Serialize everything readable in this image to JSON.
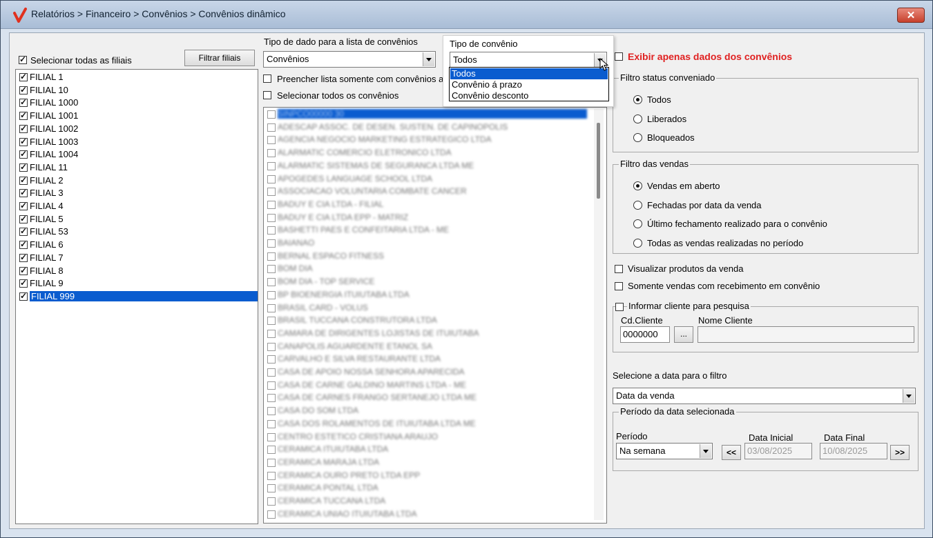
{
  "window": {
    "title": "Relatórios > Financeiro > Convênios > Convênios dinâmico",
    "close_label": "✕"
  },
  "filiais": {
    "select_all_label": "Selecionar todas as filiais",
    "filter_button": "Filtrar filiais",
    "items": [
      {
        "label": "FILIAL 1"
      },
      {
        "label": "FILIAL 10"
      },
      {
        "label": "FILIAL 1000"
      },
      {
        "label": "FILIAL 1001"
      },
      {
        "label": "FILIAL 1002"
      },
      {
        "label": "FILIAL 1003"
      },
      {
        "label": "FILIAL 1004"
      },
      {
        "label": "FILIAL 11"
      },
      {
        "label": "FILIAL 2"
      },
      {
        "label": "FILIAL 3"
      },
      {
        "label": "FILIAL 4"
      },
      {
        "label": "FILIAL 5"
      },
      {
        "label": "FILIAL 53"
      },
      {
        "label": "FILIAL 6"
      },
      {
        "label": "FILIAL 7"
      },
      {
        "label": "FILIAL 8"
      },
      {
        "label": "FILIAL 9"
      },
      {
        "label": "FILIAL 999"
      }
    ]
  },
  "tipo_dado": {
    "label": "Tipo de dado para a lista de convênios",
    "value": "Convênios"
  },
  "preencher_label": "Preencher lista somente com convênios a",
  "selecionar_todos_label": "Selecionar todos os convênios",
  "convenios": [
    "SINPCO00000 30",
    "ADESCAP ASSOC. DE DESEN. SUSTEN. DE CAPINOPOLIS",
    "AGENCIA NEGOCIO MARKETING ESTRATEGICO LTDA",
    "ALARMATIC COMERCIO ELETRONICO LTDA",
    "ALARMATIC SISTEMAS DE SEGURANCA LTDA ME",
    "APOGEDES LANGUAGE SCHOOL LTDA",
    "ASSOCIACAO VOLUNTARIA COMBATE CANCER",
    "BADUY E CIA LTDA - FILIAL",
    "BADUY E CIA LTDA EPP - MATRIZ",
    "BASHETTI PAES E CONFEITARIA LTDA - ME",
    "BAIANAO",
    "BERNAL ESPACO FITNESS",
    "BOM DIA",
    "BOM DIA - TOP SERVICE",
    "BP BIOENERGIA ITUIUTABA LTDA",
    "BRASIL CARD - VOLUS",
    "BRASIL TUCCANA CONSTRUTORA LTDA",
    "CAMARA DE DIRIGENTES LOJISTAS DE ITUIUTABA",
    "CANAPOLIS AGUARDENTE ETANOL SA",
    "CARVALHO E SILVA RESTAURANTE LTDA",
    "CASA DE APOIO NOSSA SENHORA APARECIDA",
    "CASA DE CARNE GALDINO MARTINS LTDA - ME",
    "CASA DE CARNES FRANGO SERTANEJO LTDA ME",
    "CASA DO SOM LTDA",
    "CASA DOS ROLAMENTOS DE ITUIUTABA LTDA ME",
    "CENTRO ESTETICO CRISTIANA ARAUJO",
    "CERAMICA ITUIUTABA LTDA",
    "CERAMICA MARAJA LTDA",
    "CERAMICA OURO PRETO LTDA EPP",
    "CERAMICA PONTAL LTDA",
    "CERAMICA TUCCANA LTDA",
    "CERAMICA UNIAO ITUIUTABA LTDA"
  ],
  "tipo_convenio": {
    "label": "Tipo de convênio",
    "value": "Todos",
    "options": [
      "Todos",
      "Convênio á prazo",
      "Convênio desconto"
    ]
  },
  "exibir_apenas_label": "Exibir apenas dados dos convênios",
  "filtro_status": {
    "title": "Filtro status conveniado",
    "options": [
      {
        "label": "Todos",
        "selected": true
      },
      {
        "label": "Liberados",
        "selected": false
      },
      {
        "label": "Bloqueados",
        "selected": false
      }
    ]
  },
  "filtro_vendas": {
    "title": "Filtro das vendas",
    "options": [
      {
        "label": "Vendas em aberto",
        "selected": true
      },
      {
        "label": "Fechadas por data da venda",
        "selected": false
      },
      {
        "label": "Último fechamento realizado para o convênio",
        "selected": false
      },
      {
        "label": "Todas as vendas realizadas no período",
        "selected": false
      }
    ]
  },
  "visualizar_produtos_label": "Visualizar produtos da venda",
  "somente_vendas_label": "Somente vendas com recebimento em convênio",
  "informar_cliente": {
    "title": "Informar cliente para pesquisa",
    "cd_label": "Cd.Cliente",
    "cd_value": "0000000",
    "lookup_label": "...",
    "nome_label": "Nome Cliente",
    "nome_value": ""
  },
  "data_filtro": {
    "label": "Selecione a data para o filtro",
    "value": "Data da venda"
  },
  "periodo": {
    "title": "Período da data selecionada",
    "periodo_label": "Período",
    "periodo_value": "Na semana",
    "prev_label": "<<",
    "next_label": ">>",
    "data_inicial_label": "Data Inicial",
    "data_inicial_value": "03/08/2025",
    "data_final_label": "Data Final",
    "data_final_value": "10/08/2025"
  },
  "colors": {
    "selection": "#0a5ccf",
    "highlight_red": "#e02020"
  }
}
